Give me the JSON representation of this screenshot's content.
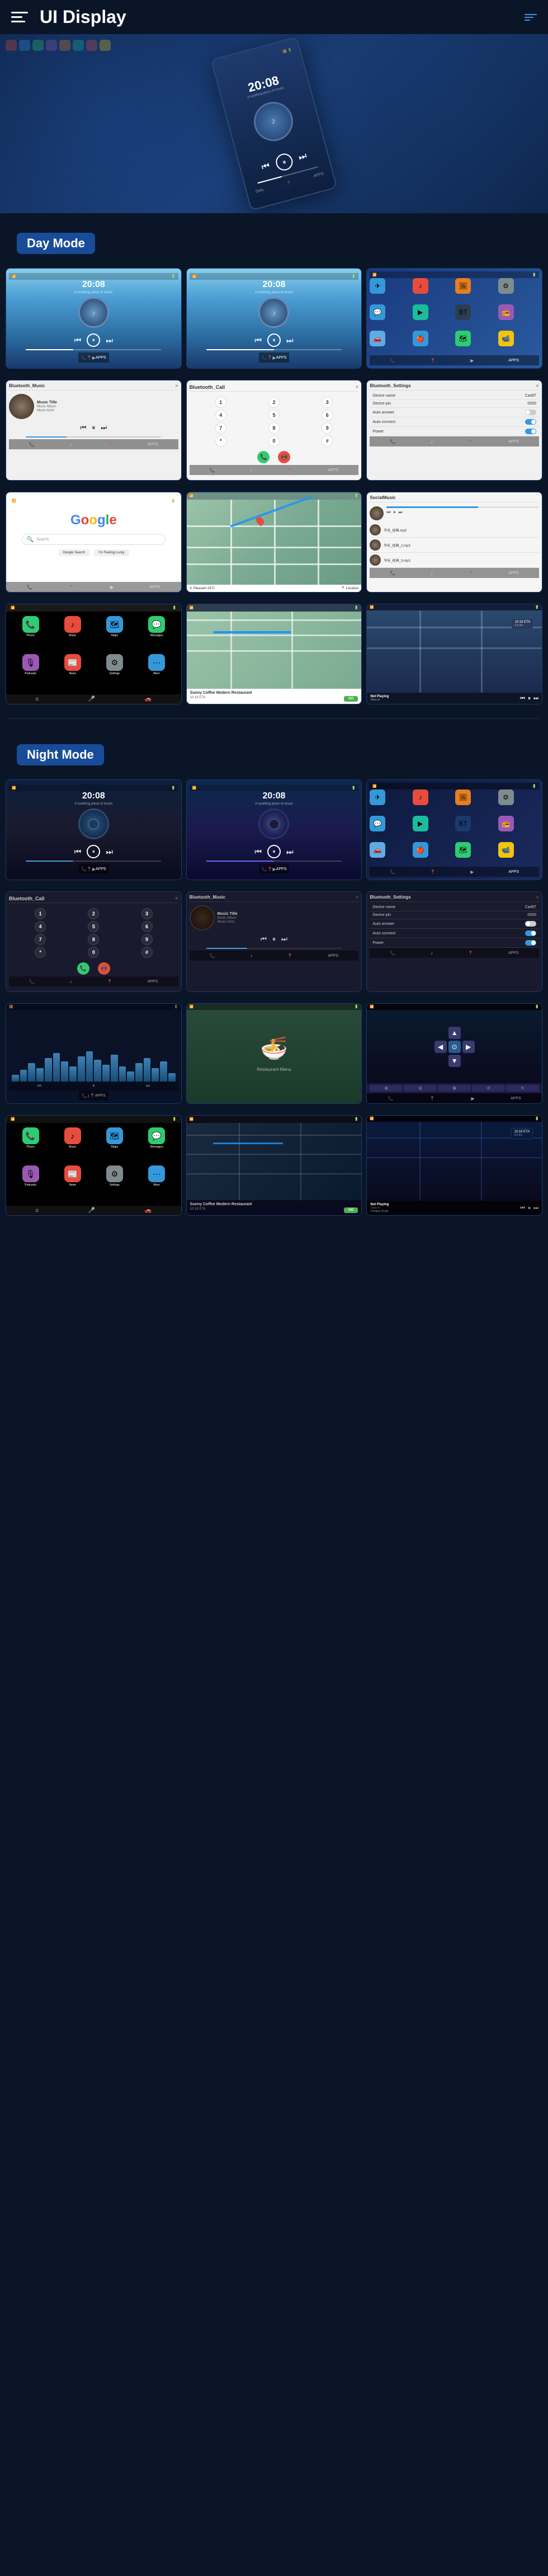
{
  "header": {
    "title": "UI Display",
    "menu_icon": "menu-icon",
    "nav_icon": "nav-lines-icon"
  },
  "day_mode": {
    "label": "Day Mode"
  },
  "night_mode": {
    "label": "Night Mode"
  },
  "music": {
    "title": "Music Title",
    "album": "Music Album",
    "artist": "Music Artist",
    "time": "20:08"
  },
  "bluetooth": {
    "music_label": "Bluetooth_Music",
    "call_label": "Bluetooth_Call",
    "settings_label": "Bluetooth_Settings"
  },
  "settings": {
    "device_name_label": "Device name",
    "device_name_value": "CarBT",
    "device_pin_label": "Device pin",
    "device_pin_value": "0000",
    "auto_answer_label": "Auto answer",
    "auto_connect_label": "Auto connect",
    "power_label": "Power"
  },
  "navigation": {
    "coffee_label": "Sunny Coffee Modern Restaurant",
    "go_label": "GO",
    "eta_label": "10:18 ETA",
    "distance_label": "9.0 km"
  },
  "social_music": {
    "title": "SocialMusic",
    "items": [
      "华乐_经典.mp3",
      "华乐_经典_2.mp3",
      "华乐_经典_3.mp3"
    ]
  },
  "carplay": {
    "icons": [
      {
        "label": "Phone",
        "color": "#2ecc71"
      },
      {
        "label": "Music",
        "color": "#e74c3c"
      },
      {
        "label": "Maps",
        "color": "#3498db"
      },
      {
        "label": "Messages",
        "color": "#2ecc71"
      },
      {
        "label": "Podcasts",
        "color": "#9b59b6"
      },
      {
        "label": "News",
        "color": "#e74c3c"
      },
      {
        "label": "Settings",
        "color": "#7f8c8d"
      },
      {
        "label": "More",
        "color": "#3498db"
      }
    ]
  },
  "screen_time": "20:08",
  "not_playing_label": "Not Playing",
  "start_on_label": "Start on",
  "dongue_road": "Donglue Road"
}
